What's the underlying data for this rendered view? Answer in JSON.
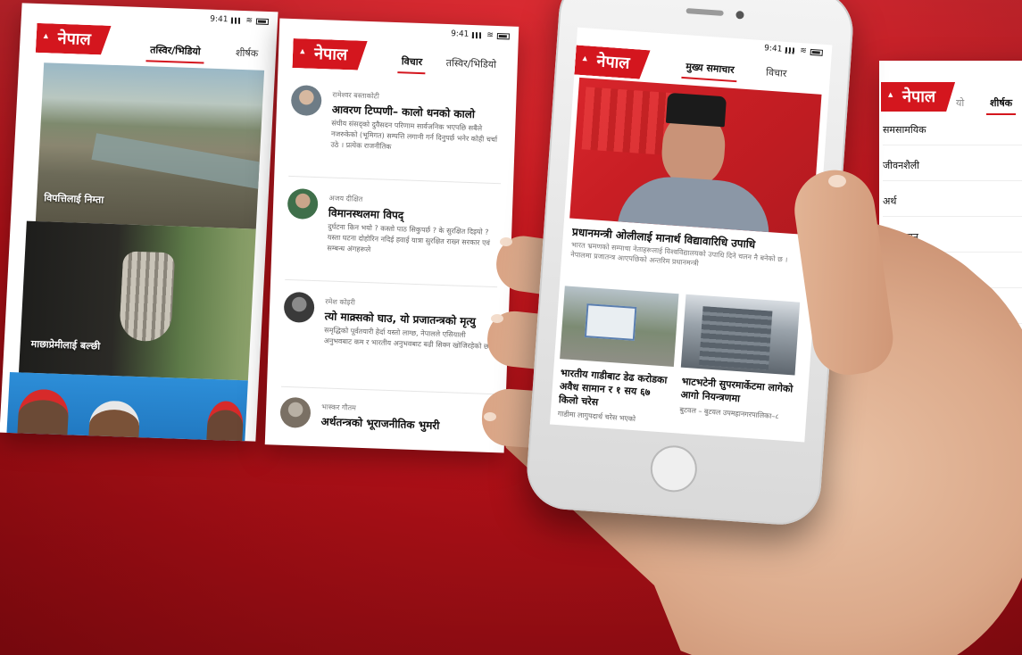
{
  "brand": {
    "logo": "नेपाल",
    "accent": "#d4161e",
    "background": "#c8141b"
  },
  "status": {
    "time": "9:41"
  },
  "screen1": {
    "tabs": [
      "तस्विर/भिडियो",
      "शीर्षक"
    ],
    "captions": [
      "विपत्तिलाई निम्ता",
      "माछाप्रेमीलाई बल्छी"
    ]
  },
  "screen2": {
    "tabs": [
      "विचार",
      "तस्विर/भिडियो"
    ],
    "items": [
      {
        "author": "रामेश्वर बस्ताकोटी",
        "title": "आवरण टिप्पणी– कालो धनको कालो",
        "excerpt": "संघीय संसद्को दुवैसदन परिणाम सार्वजनिक भएपछि सबैले नजरुकेको (भूमिगत) सम्पत्ति लगानी गर्न दिनुपर्छ भनेर कोही चर्चा उठे । प्रत्येक राजनीतिक"
      },
      {
        "author": "अजय दीक्षित",
        "title": "विमानस्थलमा विपद्",
        "excerpt": "दुर्घटना किन भयो ? कस्तो पाठ सिकुपर्छ ? के सुरक्षित दिइयो ? यस्ता घटना दोहोरिन नदिई हवाई यात्रा सुरक्षित राख्न सरकार एवं सम्बन्ध अंगहरूले"
      },
      {
        "author": "रमेश कोइरी",
        "title": "त्यो माक्र्सको घाउ, यो प्रजातन्त्रको मृत्यु",
        "excerpt": "समृद्धिको पूर्वतयारी हेर्दा यस्तो लाग्छ, नेपालले एसियाली अनुभवबाट कम र भारतीय अनुभवबाट बढी सिक्न खोजिरहेको छ ।"
      },
      {
        "author": "भास्कर गौतम",
        "title": "अर्थतन्त्रको भूराजनीतिक भुमरी",
        "excerpt": ""
      }
    ]
  },
  "phone": {
    "tabs": [
      "मुख्य समाचार",
      "विचार"
    ],
    "headline": "प्रधानमन्त्री ओलीलाई मानार्थ विद्यावारिधि उपाधि",
    "subtext": "भारत भ्रमणको सम्पाचा नेताहरूलाई विश्वविद्यालयको उपाधि दिने चलन नै बनेको छ । नेपालमा प्रजातन्त्र आएपछिको अन्तरिम प्रधानमन्त्री",
    "cards": [
      {
        "title": "भारतीय गाडीबाट डेढ करोडका अवैध सामान र १ सय ६७ किलो चरेस",
        "sub": "गाडीमा लागुपदार्थ चरेस भएको"
      },
      {
        "title": "भाटभटेनी सुपरमार्केटमा लागेको आगो नियन्त्रणमा",
        "sub": "बुटवल – बुटवल उपमहानगरपालिका–८"
      }
    ]
  },
  "screen4": {
    "logo_suffix": "यो",
    "tab": "शीर्षक",
    "categories": [
      "समसामयिक",
      "जीवनशैली",
      "अर्थ",
      "मनोरञ्जन"
    ]
  }
}
